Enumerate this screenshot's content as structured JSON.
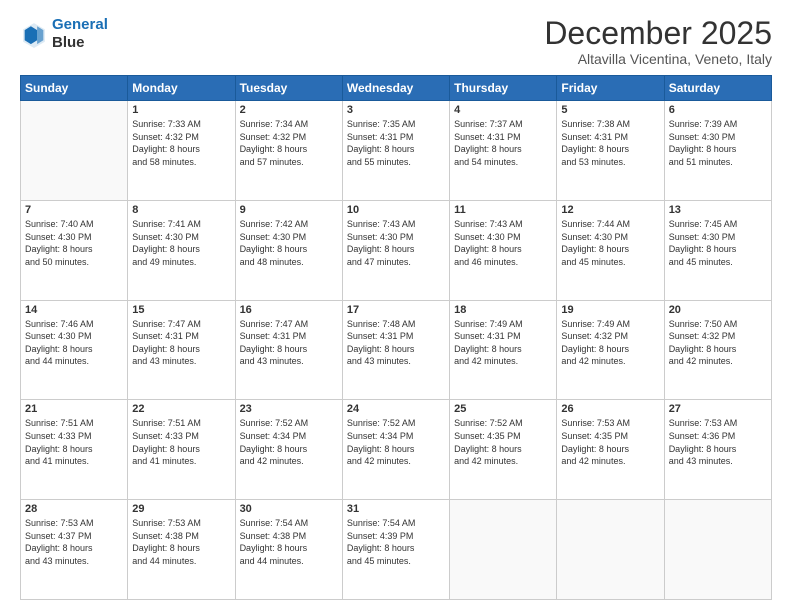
{
  "logo": {
    "line1": "General",
    "line2": "Blue"
  },
  "title": "December 2025",
  "subtitle": "Altavilla Vicentina, Veneto, Italy",
  "weekdays": [
    "Sunday",
    "Monday",
    "Tuesday",
    "Wednesday",
    "Thursday",
    "Friday",
    "Saturday"
  ],
  "weeks": [
    [
      {
        "day": "",
        "info": ""
      },
      {
        "day": "1",
        "info": "Sunrise: 7:33 AM\nSunset: 4:32 PM\nDaylight: 8 hours\nand 58 minutes."
      },
      {
        "day": "2",
        "info": "Sunrise: 7:34 AM\nSunset: 4:32 PM\nDaylight: 8 hours\nand 57 minutes."
      },
      {
        "day": "3",
        "info": "Sunrise: 7:35 AM\nSunset: 4:31 PM\nDaylight: 8 hours\nand 55 minutes."
      },
      {
        "day": "4",
        "info": "Sunrise: 7:37 AM\nSunset: 4:31 PM\nDaylight: 8 hours\nand 54 minutes."
      },
      {
        "day": "5",
        "info": "Sunrise: 7:38 AM\nSunset: 4:31 PM\nDaylight: 8 hours\nand 53 minutes."
      },
      {
        "day": "6",
        "info": "Sunrise: 7:39 AM\nSunset: 4:30 PM\nDaylight: 8 hours\nand 51 minutes."
      }
    ],
    [
      {
        "day": "7",
        "info": "Sunrise: 7:40 AM\nSunset: 4:30 PM\nDaylight: 8 hours\nand 50 minutes."
      },
      {
        "day": "8",
        "info": "Sunrise: 7:41 AM\nSunset: 4:30 PM\nDaylight: 8 hours\nand 49 minutes."
      },
      {
        "day": "9",
        "info": "Sunrise: 7:42 AM\nSunset: 4:30 PM\nDaylight: 8 hours\nand 48 minutes."
      },
      {
        "day": "10",
        "info": "Sunrise: 7:43 AM\nSunset: 4:30 PM\nDaylight: 8 hours\nand 47 minutes."
      },
      {
        "day": "11",
        "info": "Sunrise: 7:43 AM\nSunset: 4:30 PM\nDaylight: 8 hours\nand 46 minutes."
      },
      {
        "day": "12",
        "info": "Sunrise: 7:44 AM\nSunset: 4:30 PM\nDaylight: 8 hours\nand 45 minutes."
      },
      {
        "day": "13",
        "info": "Sunrise: 7:45 AM\nSunset: 4:30 PM\nDaylight: 8 hours\nand 45 minutes."
      }
    ],
    [
      {
        "day": "14",
        "info": "Sunrise: 7:46 AM\nSunset: 4:30 PM\nDaylight: 8 hours\nand 44 minutes."
      },
      {
        "day": "15",
        "info": "Sunrise: 7:47 AM\nSunset: 4:31 PM\nDaylight: 8 hours\nand 43 minutes."
      },
      {
        "day": "16",
        "info": "Sunrise: 7:47 AM\nSunset: 4:31 PM\nDaylight: 8 hours\nand 43 minutes."
      },
      {
        "day": "17",
        "info": "Sunrise: 7:48 AM\nSunset: 4:31 PM\nDaylight: 8 hours\nand 43 minutes."
      },
      {
        "day": "18",
        "info": "Sunrise: 7:49 AM\nSunset: 4:31 PM\nDaylight: 8 hours\nand 42 minutes."
      },
      {
        "day": "19",
        "info": "Sunrise: 7:49 AM\nSunset: 4:32 PM\nDaylight: 8 hours\nand 42 minutes."
      },
      {
        "day": "20",
        "info": "Sunrise: 7:50 AM\nSunset: 4:32 PM\nDaylight: 8 hours\nand 42 minutes."
      }
    ],
    [
      {
        "day": "21",
        "info": "Sunrise: 7:51 AM\nSunset: 4:33 PM\nDaylight: 8 hours\nand 41 minutes."
      },
      {
        "day": "22",
        "info": "Sunrise: 7:51 AM\nSunset: 4:33 PM\nDaylight: 8 hours\nand 41 minutes."
      },
      {
        "day": "23",
        "info": "Sunrise: 7:52 AM\nSunset: 4:34 PM\nDaylight: 8 hours\nand 42 minutes."
      },
      {
        "day": "24",
        "info": "Sunrise: 7:52 AM\nSunset: 4:34 PM\nDaylight: 8 hours\nand 42 minutes."
      },
      {
        "day": "25",
        "info": "Sunrise: 7:52 AM\nSunset: 4:35 PM\nDaylight: 8 hours\nand 42 minutes."
      },
      {
        "day": "26",
        "info": "Sunrise: 7:53 AM\nSunset: 4:35 PM\nDaylight: 8 hours\nand 42 minutes."
      },
      {
        "day": "27",
        "info": "Sunrise: 7:53 AM\nSunset: 4:36 PM\nDaylight: 8 hours\nand 43 minutes."
      }
    ],
    [
      {
        "day": "28",
        "info": "Sunrise: 7:53 AM\nSunset: 4:37 PM\nDaylight: 8 hours\nand 43 minutes."
      },
      {
        "day": "29",
        "info": "Sunrise: 7:53 AM\nSunset: 4:38 PM\nDaylight: 8 hours\nand 44 minutes."
      },
      {
        "day": "30",
        "info": "Sunrise: 7:54 AM\nSunset: 4:38 PM\nDaylight: 8 hours\nand 44 minutes."
      },
      {
        "day": "31",
        "info": "Sunrise: 7:54 AM\nSunset: 4:39 PM\nDaylight: 8 hours\nand 45 minutes."
      },
      {
        "day": "",
        "info": ""
      },
      {
        "day": "",
        "info": ""
      },
      {
        "day": "",
        "info": ""
      }
    ]
  ]
}
